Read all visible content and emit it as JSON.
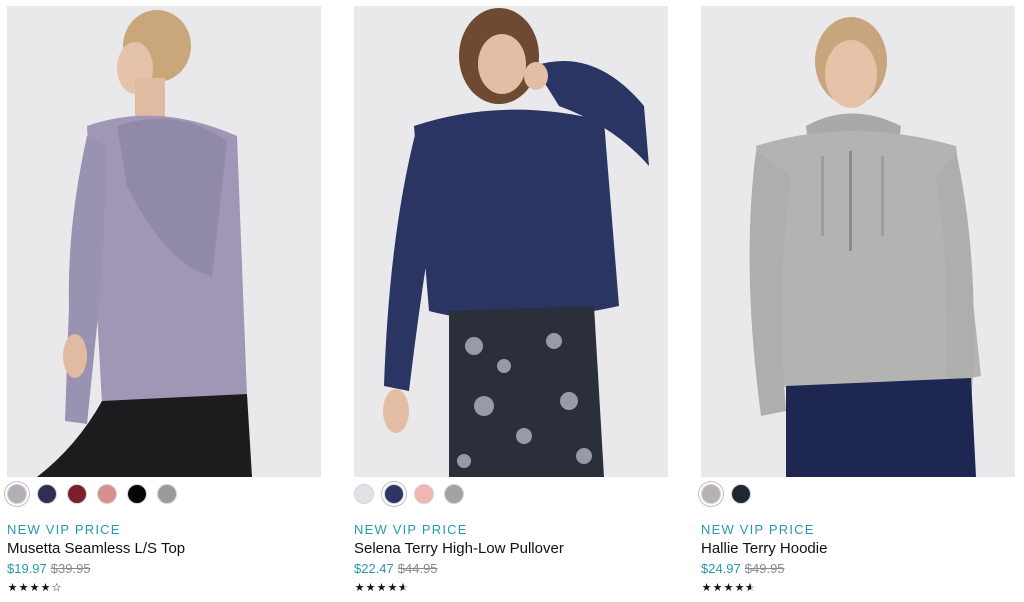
{
  "products": [
    {
      "promo": "NEW VIP PRICE",
      "name": "Musetta Seamless L/S Top",
      "sale_price": "$19.97",
      "original_price": "$39.95",
      "rating": 4,
      "rating_max": 5,
      "photo": {
        "garment_color": "#9f97b5",
        "pants_color": "#1c1c1e",
        "background": "#e8e8ea"
      },
      "swatches": [
        "#b7adb8",
        "#2f2e57",
        "#7c1f2c",
        "#d98f8f",
        "#050505",
        "#9a9a9a"
      ],
      "selected_swatch": 0
    },
    {
      "promo": "NEW VIP PRICE",
      "name": "Selena Terry High-Low Pullover",
      "sale_price": "$22.47",
      "original_price": "$44.95",
      "rating": 4.5,
      "rating_max": 5,
      "photo": {
        "garment_color": "#2a3563",
        "pants_color": "#2b2f3a",
        "background": "#e8e8ea"
      },
      "swatches": [
        "#e1e1e8",
        "#2f3562",
        "#f0b6b0",
        "#a3a3a3"
      ],
      "selected_swatch": 1
    },
    {
      "promo": "NEW VIP PRICE",
      "name": "Hallie Terry Hoodie",
      "sale_price": "$24.97",
      "original_price": "$49.95",
      "rating": 4.5,
      "rating_max": 5,
      "photo": {
        "garment_color": "#b3b3b1",
        "pants_color": "#1e2652",
        "background": "#e8e8ea"
      },
      "swatches": [
        "#b5b1b4",
        "#202734"
      ],
      "selected_swatch": 0
    }
  ]
}
